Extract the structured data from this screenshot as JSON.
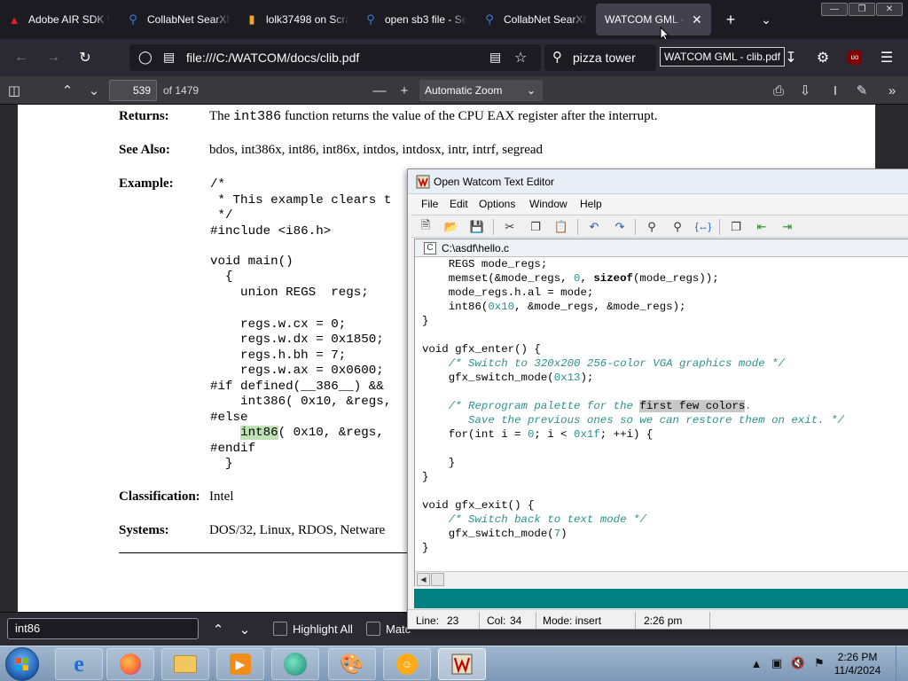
{
  "browser": {
    "tabs": [
      {
        "label": "Adobe AIR SDK f",
        "icon": "acrobat-icon",
        "color": "#e01f28"
      },
      {
        "label": "CollabNet SearXN",
        "icon": "searx-icon",
        "color": "#3e7bd6"
      },
      {
        "label": "lolk37498 on Scra",
        "icon": "document-icon",
        "color": "#f5a623"
      },
      {
        "label": "open sb3 file - Se",
        "icon": "searx-icon",
        "color": "#3e7bd6"
      },
      {
        "label": "CollabNet SearXN",
        "icon": "searx-icon",
        "color": "#3e7bd6"
      },
      {
        "label": "WATCOM GML - c",
        "icon": "",
        "color": ""
      }
    ],
    "url": "file:///C:/WATCOM/docs/clib.pdf",
    "search_text": "pizza tower",
    "tooltip": "WATCOM GML - clib.pdf"
  },
  "pdf_toolbar": {
    "page_number": "539",
    "page_of": "of 1479",
    "zoom": "Automatic Zoom"
  },
  "pdf_page": {
    "returns_label": "Returns:",
    "returns_pre": "The ",
    "returns_code": "int386",
    "returns_post": " function returns the value of the CPU EAX register after the interrupt.",
    "see_also_label": "See Also:",
    "see_also_text": "bdos, int386x, int86, int86x, intdos, intdosx, intr, intrf, segread",
    "example_label": "Example:",
    "code_lines": [
      "/*",
      " * This example clears t",
      " */",
      "#include <i86.h>",
      "",
      "void main()",
      "  {",
      "    union REGS  regs;",
      "",
      "    regs.w.cx = 0;",
      "    regs.w.dx = 0x1850;",
      "    regs.h.bh = 7;",
      "    regs.w.ax = 0x0600;",
      "#if defined(__386__) &&",
      "    int386( 0x10, &regs,",
      "#else",
      "    ",
      "#endif",
      "  }"
    ],
    "find_line_indent": "    ",
    "find_match": "int86",
    "find_line_rest": "( 0x10, &regs,",
    "classification_label": "Classification:",
    "classification_text": "Intel",
    "systems_label": "Systems:",
    "systems_text": "DOS/32, Linux, RDOS, Netware"
  },
  "findbar": {
    "query": "int86",
    "highlight_all": "Highlight All",
    "match_case_partial": "Matc"
  },
  "editor": {
    "title": "Open Watcom Text Editor",
    "menus": [
      "File",
      "Edit",
      "Options",
      "Window",
      "Help"
    ],
    "file_title": "C:\\asdf\\hello.c",
    "status": {
      "line_label": "Line:",
      "line_value": "23",
      "col_label": "Col:",
      "col_value": "34",
      "mode": "Mode: insert",
      "time": "2:26 pm"
    },
    "code": {
      "l1": "    REGS mode_regs;",
      "l2a": "    memset(&mode_regs, ",
      "l2b": "0",
      "l2c": ", ",
      "l2d": "sizeof",
      "l2e": "(mode_regs));",
      "l3": "    mode_regs.h.al = mode;",
      "l4a": "    int86(",
      "l4b": "0x10",
      "l4c": ", &mode_regs, &mode_regs);",
      "l5": "}",
      "l7": "void gfx_enter() {",
      "l8i": "    ",
      "l8": "/* Switch to 320x200 256-color VGA graphics mode */",
      "l9a": "    gfx_switch_mode(",
      "l9b": "0x13",
      "l9c": ");",
      "l11i": "    ",
      "l11a": "/* Reprogram palette for the ",
      "l11b": "first few colors",
      "l11c": ".",
      "l12": "       Save the previous ones so we can restore them on exit. */",
      "l13a": "    for(int i = ",
      "l13b": "0",
      "l13c": "; i < ",
      "l13d": "0x1f",
      "l13e": "; ++i) {",
      "l15": "    }",
      "l16": "}",
      "l18": "void gfx_exit() {",
      "l19i": "    ",
      "l19": "/* Switch back to text mode */",
      "l20a": "    gfx_switch_mode(",
      "l20b": "7",
      "l20c": ")",
      "l21": "}"
    }
  },
  "taskbar": {
    "time": "2:26 PM",
    "date": "11/4/2024"
  }
}
